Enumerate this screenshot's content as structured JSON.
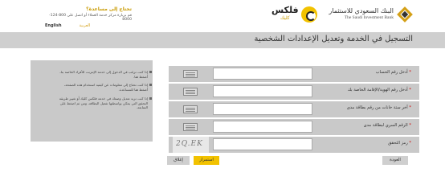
{
  "header": {
    "bank_name_ar": "البنك السعودي للاستثمار",
    "bank_name_en": "The Saudi Investment Bank",
    "flex_name": "فلكس",
    "flex_sub": "كليك",
    "help_title": "تحتاج إلى مساعدة؟",
    "help_text": "قم بزيارة مركز خدمة العملاء أو اتصل على 800-124-8000",
    "lang_en": "English",
    "lang_ar": "العربية"
  },
  "page": {
    "title": "التسجيل في الخدمة وتعديل الإعدادات الشخصية"
  },
  "info": {
    "items": [
      {
        "text": "إذا كنت ترغب في الدخول إلى خدمة الإنترنت للأفراد الخاصة بنا، أضغط هنا."
      },
      {
        "text": "إذا كنت تحتاج إلى معلومات عن كيفية استخدام هذه الصفحة، أضغط هنا للمساعدة."
      },
      {
        "text": "إذا كنت تريد تعديل وضعك في خدمة فلكس كليك أو تغيير طريقة التحقق التي يمكن بواسطتها تفعيل البطاقة، ومن ثم اضغط على المتابعة."
      }
    ]
  },
  "form": {
    "rows": [
      {
        "label": "أدخل رقم الحساب",
        "required": "*",
        "has_keyboard": true
      },
      {
        "label": "أدخل رقم الهوية/الإقامة الخاصة بك",
        "required": "*",
        "has_keyboard": true
      },
      {
        "label": "آخر ستة خانات من رقم بطاقة مدى",
        "required": "*",
        "has_keyboard": true
      },
      {
        "label": "الرقم السري لبطاقة مدى",
        "required": "*",
        "has_keyboard": true
      },
      {
        "label": "رمز التحقق",
        "required": "*",
        "has_keyboard": false,
        "captcha": "2Q.EK"
      }
    ]
  },
  "buttons": {
    "back": "العودة",
    "continue": "استمرار",
    "close": "إغلاق"
  }
}
